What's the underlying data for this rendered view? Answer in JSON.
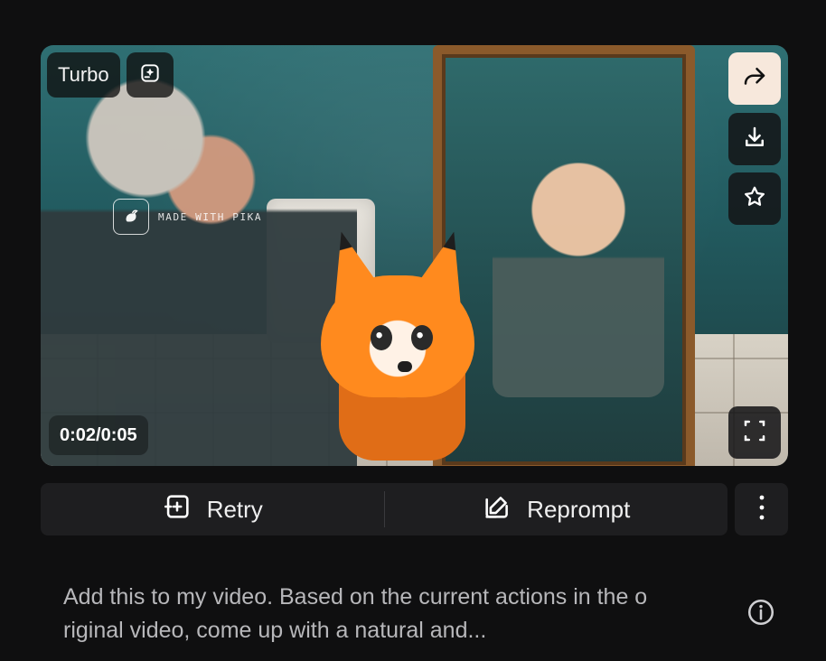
{
  "video": {
    "badge_label": "Turbo",
    "watermark_text": "MADE WITH PIKA",
    "timecode": "0:02/0:05"
  },
  "actions": {
    "retry_label": "Retry",
    "reprompt_label": "Reprompt"
  },
  "prompt": {
    "text": "Add this to my video. Based on the current actions in the o\nriginal video, come up with a natural and..."
  },
  "icons": {
    "badge_action": "sparkle-image-icon",
    "share": "share-arrow-icon",
    "download": "download-icon",
    "star": "star-icon",
    "fullscreen": "fullscreen-icon",
    "retry": "retry-square-plus-icon",
    "reprompt": "edit-pencil-icon",
    "more": "vertical-dots-icon",
    "info": "info-icon"
  },
  "colors": {
    "background": "#0f0f10",
    "button_bg": "#1e1e20",
    "share_bg": "#f7e8dc"
  }
}
